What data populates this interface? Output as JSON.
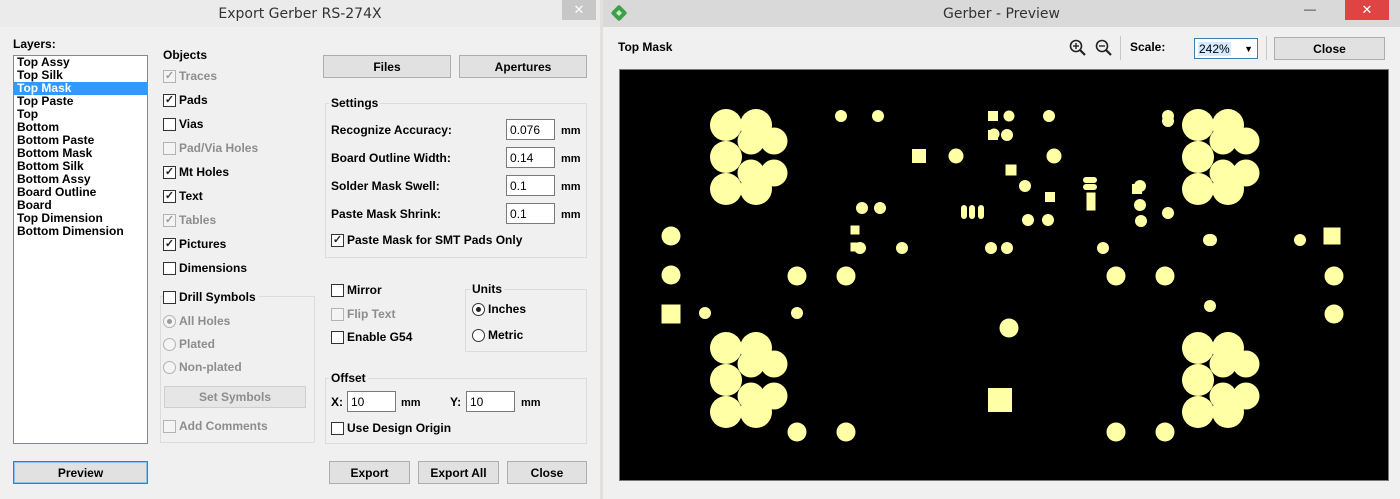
{
  "export_dialog": {
    "title": "Export Gerber RS-274X",
    "close_glyph": "✕",
    "layers_label": "Layers:",
    "layers": [
      {
        "label": "Top Assy",
        "selected": false
      },
      {
        "label": "Top Silk",
        "selected": false
      },
      {
        "label": "Top Mask",
        "selected": true
      },
      {
        "label": "Top Paste",
        "selected": false
      },
      {
        "label": "Top",
        "selected": false
      },
      {
        "label": "Bottom",
        "selected": false
      },
      {
        "label": "Bottom Paste",
        "selected": false
      },
      {
        "label": "Bottom Mask",
        "selected": false
      },
      {
        "label": "Bottom Silk",
        "selected": false
      },
      {
        "label": "Bottom Assy",
        "selected": false
      },
      {
        "label": "Board Outline",
        "selected": false
      },
      {
        "label": "Board",
        "selected": false
      },
      {
        "label": "Top Dimension",
        "selected": false
      },
      {
        "label": "Bottom Dimension",
        "selected": false
      }
    ],
    "objects_label": "Objects",
    "objects": [
      {
        "label": "Traces",
        "checked": true,
        "enabled": false
      },
      {
        "label": "Pads",
        "checked": true,
        "enabled": true
      },
      {
        "label": "Vias",
        "checked": false,
        "enabled": true
      },
      {
        "label": "Pad/Via Holes",
        "checked": false,
        "enabled": false
      },
      {
        "label": "Mt Holes",
        "checked": true,
        "enabled": true
      },
      {
        "label": "Text",
        "checked": true,
        "enabled": true
      },
      {
        "label": "Tables",
        "checked": true,
        "enabled": false
      },
      {
        "label": "Pictures",
        "checked": true,
        "enabled": true
      },
      {
        "label": "Dimensions",
        "checked": false,
        "enabled": true
      }
    ],
    "drill_symbols": {
      "label": "Drill Symbols",
      "checked": false,
      "options": [
        {
          "label": "All Holes",
          "selected": true
        },
        {
          "label": "Plated",
          "selected": false
        },
        {
          "label": "Non-plated",
          "selected": false
        }
      ],
      "set_symbols_label": "Set Symbols",
      "add_comments_label": "Add Comments"
    },
    "files_label": "Files",
    "apertures_label": "Apertures",
    "settings_label": "Settings",
    "settings": [
      {
        "label": "Recognize Accuracy:",
        "value": "0.076",
        "unit": "mm"
      },
      {
        "label": "Board Outline Width:",
        "value": "0.14",
        "unit": "mm"
      },
      {
        "label": "Solder Mask Swell:",
        "value": "0.1",
        "unit": "mm"
      },
      {
        "label": "Paste Mask Shrink:",
        "value": "0.1",
        "unit": "mm"
      }
    ],
    "paste_mask_smt_label": "Paste Mask for SMT Pads Only",
    "mirror_label": "Mirror",
    "flip_text_label": "Flip Text",
    "enable_g54_label": "Enable G54",
    "units_label": "Units",
    "units": [
      {
        "label": "Inches",
        "selected": true
      },
      {
        "label": "Metric",
        "selected": false
      }
    ],
    "offset_label": "Offset",
    "offset_x_label": "X:",
    "offset_x_value": "10",
    "offset_y_label": "Y:",
    "offset_y_value": "10",
    "offset_unit": "mm",
    "use_design_origin_label": "Use Design Origin",
    "preview_label": "Preview",
    "export_label": "Export",
    "export_all_label": "Export All",
    "close_label": "Close"
  },
  "preview_window": {
    "title": "Gerber - Preview",
    "minimize_glyph": "—",
    "close_glyph": "✕",
    "layer_name": "Top Mask",
    "scale_label": "Scale:",
    "scale_value": "242%",
    "close_label": "Close",
    "colors": {
      "board": "#000000",
      "pad": "#ffffa6"
    }
  }
}
